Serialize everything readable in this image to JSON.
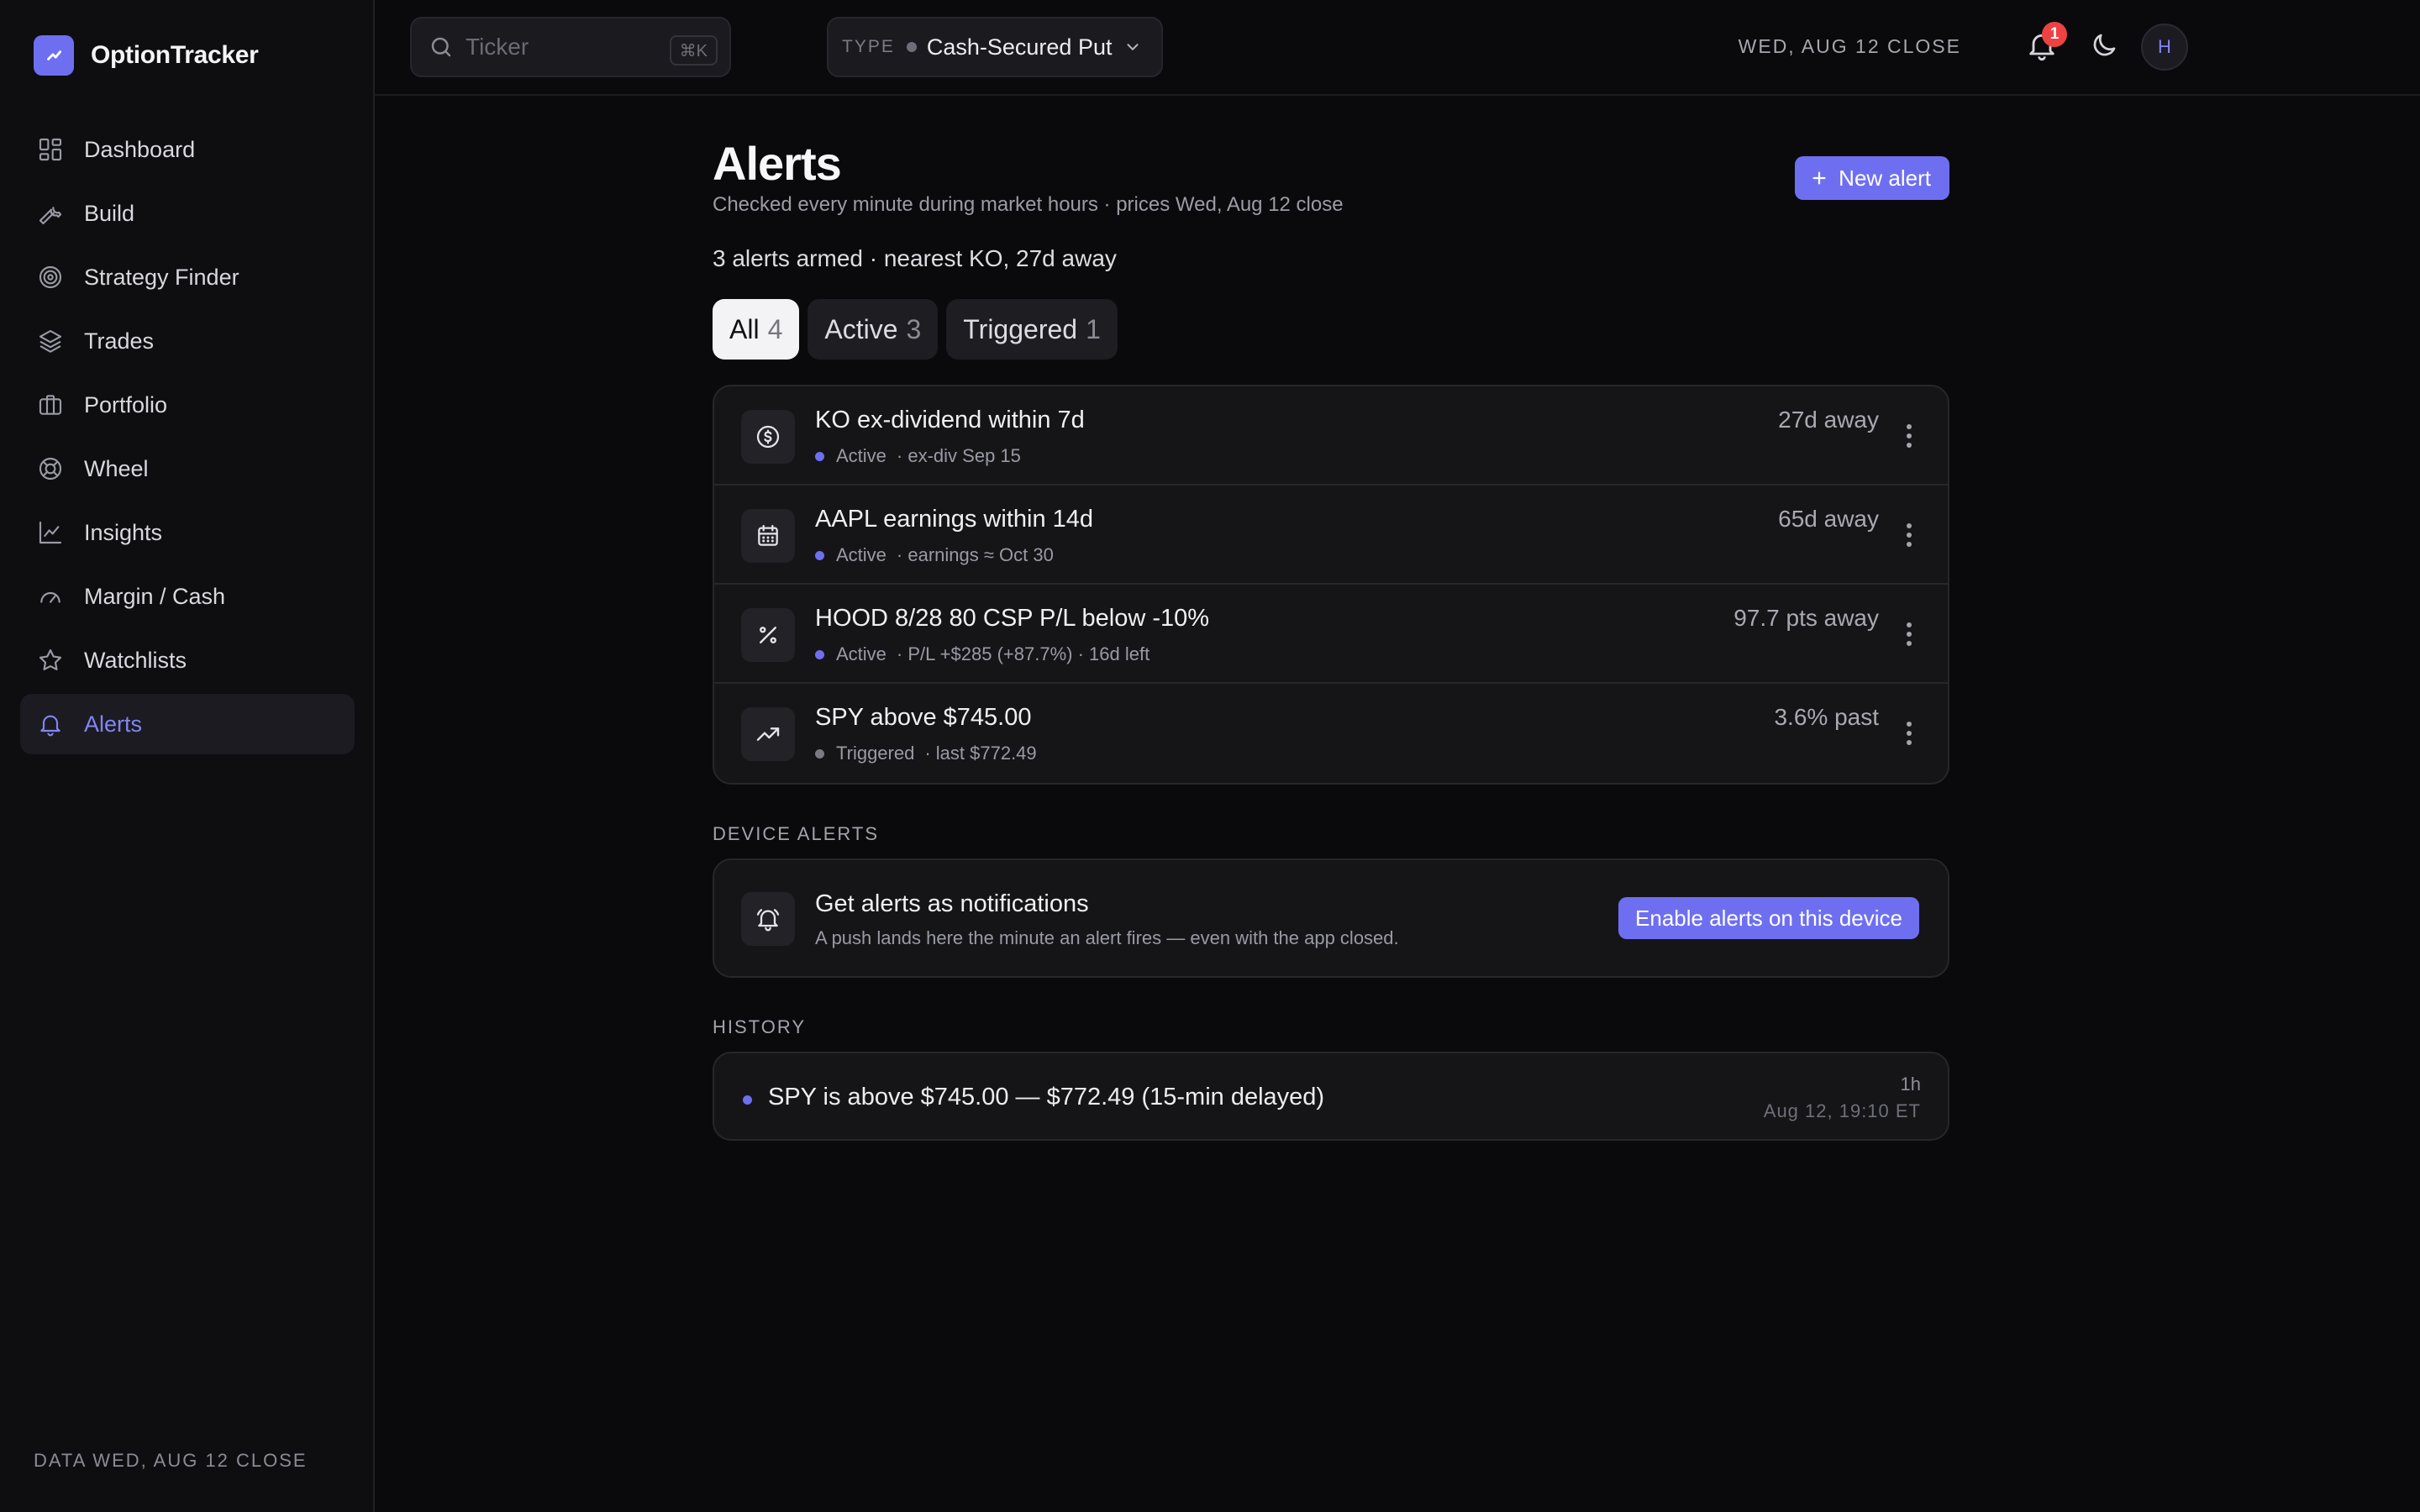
{
  "app": {
    "name": "OptionTracker",
    "logo_icon": "chart-line-icon",
    "accent": "#6e6ff0"
  },
  "sidebar": {
    "items": [
      {
        "label": "Dashboard",
        "icon": "grid-icon"
      },
      {
        "label": "Build",
        "icon": "wrench-icon"
      },
      {
        "label": "Strategy Finder",
        "icon": "target-icon"
      },
      {
        "label": "Trades",
        "icon": "layers-icon"
      },
      {
        "label": "Portfolio",
        "icon": "briefcase-icon"
      },
      {
        "label": "Wheel",
        "icon": "lifebuoy-icon"
      },
      {
        "label": "Insights",
        "icon": "line-chart-icon"
      },
      {
        "label": "Margin / Cash",
        "icon": "gauge-icon"
      },
      {
        "label": "Watchlists",
        "icon": "star-icon"
      },
      {
        "label": "Alerts",
        "icon": "bell-icon",
        "active": true
      }
    ],
    "footer": "DATA WED, AUG 12 CLOSE"
  },
  "topbar": {
    "search_placeholder": "Ticker",
    "search_shortcut": "⌘K",
    "type_label": "TYPE",
    "type_value": "Cash-Secured Put",
    "close_date": "WED, AUG 12 CLOSE",
    "notification_count": "1",
    "avatar_initial": "H"
  },
  "page": {
    "title": "Alerts",
    "subtitle": "Checked every minute during market hours · prices Wed, Aug 12 close",
    "new_alert_label": "New alert",
    "summary": "3 alerts armed · nearest KO, 27d away"
  },
  "filters": [
    {
      "label": "All",
      "count": "4",
      "active": true
    },
    {
      "label": "Active",
      "count": "3"
    },
    {
      "label": "Triggered",
      "count": "1"
    }
  ],
  "alerts": [
    {
      "title": "KO ex-dividend within 7d",
      "status": "Active",
      "detail": "· ex-div Sep 15",
      "distance": "27d away",
      "icon": "dollar-circle-icon"
    },
    {
      "title": "AAPL earnings within 14d",
      "status": "Active",
      "detail": "· earnings ≈ Oct 30",
      "distance": "65d away",
      "icon": "calendar-icon"
    },
    {
      "title": "HOOD 8/28 80 CSP P/L below -10%",
      "status": "Active",
      "detail": "· P/L +$285 (+87.7%) · 16d left",
      "distance": "97.7 pts away",
      "icon": "percent-icon"
    },
    {
      "title": "SPY above $745.00",
      "status": "Triggered",
      "detail": "· last $772.49",
      "distance": "3.6% past",
      "icon": "trending-up-icon"
    }
  ],
  "device": {
    "section_label": "DEVICE ALERTS",
    "title": "Get alerts as notifications",
    "subtitle": "A push lands here the minute an alert fires — even with the app closed.",
    "button_label": "Enable alerts on this device"
  },
  "history": {
    "section_label": "HISTORY",
    "entries": [
      {
        "text": "SPY is above $745.00 — $772.49 (15-min delayed)",
        "ago": "1h",
        "time": "Aug 12, 19:10 ET"
      }
    ]
  }
}
